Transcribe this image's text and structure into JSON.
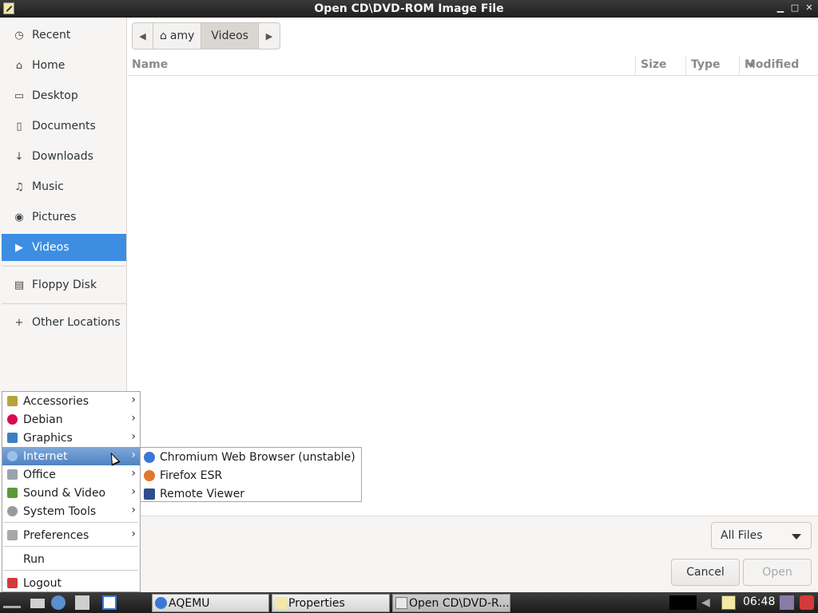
{
  "window": {
    "title": "Open CD\\DVD-ROM Image File"
  },
  "sidebar": {
    "items": [
      {
        "label": "Recent",
        "icon": "clock-icon"
      },
      {
        "label": "Home",
        "icon": "home-icon"
      },
      {
        "label": "Desktop",
        "icon": "folder-icon"
      },
      {
        "label": "Documents",
        "icon": "document-icon"
      },
      {
        "label": "Downloads",
        "icon": "download-icon"
      },
      {
        "label": "Music",
        "icon": "music-icon"
      },
      {
        "label": "Pictures",
        "icon": "camera-icon"
      },
      {
        "label": "Videos",
        "icon": "video-icon",
        "active": true
      },
      {
        "label": "Floppy Disk",
        "icon": "drive-icon"
      },
      {
        "label": "Other Locations",
        "icon": "plus-icon"
      }
    ]
  },
  "pathbar": {
    "segments": [
      "amy",
      "Videos"
    ]
  },
  "columns": {
    "name": "Name",
    "size": "Size",
    "type": "Type",
    "modified": "Modified"
  },
  "filter": {
    "selected": "All Files"
  },
  "buttons": {
    "cancel": "Cancel",
    "open": "Open"
  },
  "menu": {
    "items": [
      {
        "label": "Accessories",
        "submenu": true,
        "color": "#b5a33a"
      },
      {
        "label": "Debian",
        "submenu": true,
        "color": "#d70a53"
      },
      {
        "label": "Graphics",
        "submenu": true,
        "color": "#3b7fc4"
      },
      {
        "label": "Internet",
        "submenu": true,
        "color": "#4a80c8",
        "highlighted": true
      },
      {
        "label": "Office",
        "submenu": true,
        "color": "#9aa3ad"
      },
      {
        "label": "Sound & Video",
        "submenu": true,
        "color": "#5a9a3a"
      },
      {
        "label": "System Tools",
        "submenu": true,
        "color": "#9a9a9a"
      },
      {
        "label": "Preferences",
        "submenu": true,
        "color": "#a8a8a8"
      },
      {
        "label": "Run",
        "submenu": false
      },
      {
        "label": "Logout",
        "submenu": false,
        "color": "#d33b3b"
      }
    ],
    "internet_submenu": [
      {
        "label": "Chromium Web Browser (unstable)",
        "color": "#3a78d8"
      },
      {
        "label": "Firefox ESR",
        "color": "#e0782a"
      },
      {
        "label": "Remote Viewer",
        "color": "#2e4d8a"
      }
    ]
  },
  "taskbar": {
    "tasks": [
      {
        "label": "AQEMU"
      },
      {
        "label": "Properties"
      },
      {
        "label": "Open CD\\DVD-R..."
      }
    ],
    "clock": "06:48"
  }
}
